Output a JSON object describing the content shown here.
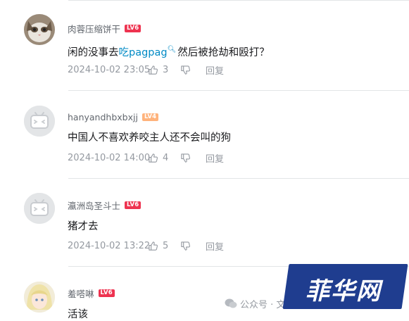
{
  "comments": [
    {
      "username": "肉蓉压缩饼干",
      "level": "LV6",
      "text_before": "闲的没事去",
      "link": "吃pagpag",
      "link_icon": "search-icon",
      "text_after": "然后被抢劫和殴打？",
      "time": "2024-10-02 23:05",
      "likes": "3",
      "reply": "回复"
    },
    {
      "username": "hanyandhbxbxjj",
      "level": "LV4",
      "text": "中国人不喜欢养咬主人还不会叫的狗",
      "time": "2024-10-02 14:00",
      "likes": "4",
      "reply": "回复"
    },
    {
      "username": "瀛洲岛圣斗士",
      "level": "LV6",
      "text": "猪才去",
      "time": "2024-10-02 13:22",
      "likes": "5",
      "reply": "回复"
    },
    {
      "username": "羞嗒啉",
      "level": "LV6",
      "text": "活该"
    }
  ],
  "watermark": {
    "brand": "菲华网",
    "account_label": "公众号 · 文"
  },
  "colors": {
    "link": "#008ac5",
    "level_red": "#ee3350",
    "level_orange": "#ffb37c",
    "meta_gray": "#9499a0",
    "watermark_blue": "#1f3d8f"
  }
}
